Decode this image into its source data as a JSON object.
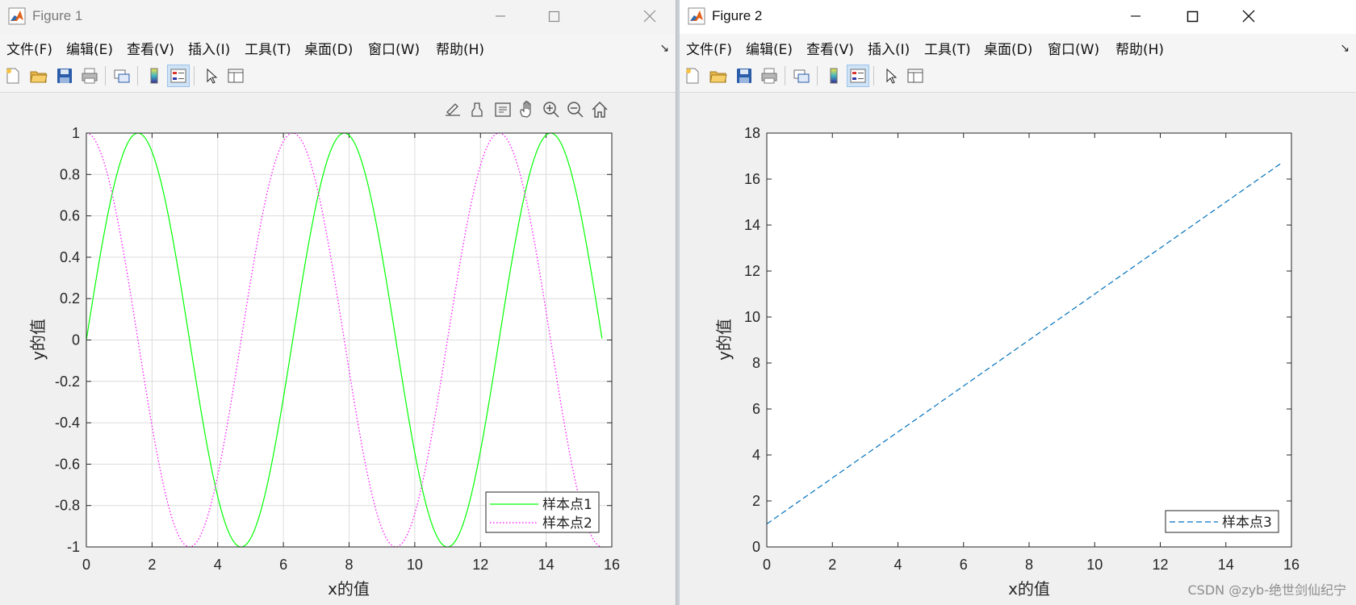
{
  "figure1": {
    "title": "Figure 1",
    "menu": [
      "文件(F)",
      "编辑(E)",
      "查看(V)",
      "插入(I)",
      "工具(T)",
      "桌面(D)",
      "窗口(W)",
      "帮助(H)"
    ],
    "toolbar_icons": [
      "new-file-icon",
      "open-folder-icon",
      "save-icon",
      "print-icon",
      "link-plot-icon",
      "colorbar-icon",
      "legend-icon",
      "pointer-icon",
      "property-inspector-icon"
    ],
    "axes_toolbar_icons": [
      "brush-edit-icon",
      "data-brush-icon",
      "data-tips-icon",
      "pan-hand-icon",
      "zoom-in-icon",
      "zoom-out-icon",
      "home-icon"
    ]
  },
  "figure2": {
    "title": "Figure 2",
    "menu": [
      "文件(F)",
      "编辑(E)",
      "查看(V)",
      "插入(I)",
      "工具(T)",
      "桌面(D)",
      "窗口(W)",
      "帮助(H)"
    ],
    "toolbar_icons": [
      "new-file-icon",
      "open-folder-icon",
      "save-icon",
      "print-icon",
      "link-plot-icon",
      "colorbar-icon",
      "legend-icon",
      "pointer-icon",
      "property-inspector-icon"
    ]
  },
  "watermark": "CSDN @zyb-绝世剑仙纪宁",
  "chart_data": [
    {
      "type": "line",
      "xlabel": "x的值",
      "ylabel": "y的值",
      "xlim": [
        0,
        16
      ],
      "ylim": [
        -1,
        1
      ],
      "xticks": [
        "0",
        "2",
        "4",
        "6",
        "8",
        "10",
        "12",
        "14",
        "16"
      ],
      "yticks": [
        "-1",
        "-0.8",
        "-0.6",
        "-0.4",
        "-0.2",
        "0",
        "0.2",
        "0.4",
        "0.6",
        "0.8",
        "1"
      ],
      "grid": true,
      "legend_position": "bottom-right",
      "series": [
        {
          "name": "样本点1",
          "function": "sin(x)",
          "x_range": [
            0,
            15.7
          ],
          "style": "solid",
          "color": "#00ff00"
        },
        {
          "name": "样本点2",
          "function": "cos(x)",
          "x_range": [
            0,
            15.7
          ],
          "style": "dotted",
          "color": "#ff00ff"
        }
      ]
    },
    {
      "type": "line",
      "xlabel": "x的值",
      "ylabel": "y的值",
      "xlim": [
        0,
        16
      ],
      "ylim": [
        0,
        18
      ],
      "xticks": [
        "0",
        "2",
        "4",
        "6",
        "8",
        "10",
        "12",
        "14",
        "16"
      ],
      "yticks": [
        "0",
        "2",
        "4",
        "6",
        "8",
        "10",
        "12",
        "14",
        "16",
        "18"
      ],
      "grid": false,
      "legend_position": "bottom-right",
      "series": [
        {
          "name": "样本点3",
          "x": [
            0,
            15.7
          ],
          "y": [
            1,
            16.7
          ],
          "style": "dashed",
          "color": "#0072bd"
        }
      ]
    }
  ]
}
